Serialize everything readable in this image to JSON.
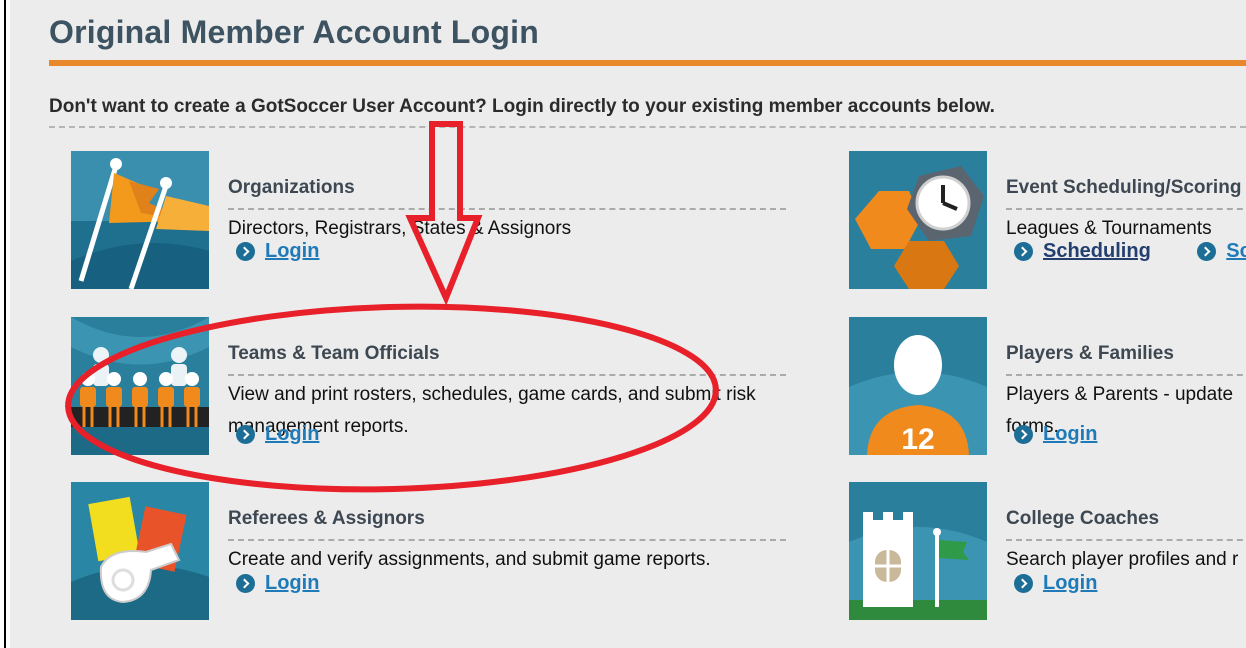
{
  "page": {
    "title": "Original Member Account Login",
    "intro": "Don't want to create a GotSoccer User Account? Login directly to your existing member accounts below."
  },
  "accounts": [
    {
      "title": "Organizations",
      "description": "Directors, Registrars, States & Assignors",
      "links": [
        {
          "label": "Login"
        }
      ],
      "icon": "flags-icon"
    },
    {
      "title": "Teams & Team Officials",
      "description": "View and print rosters, schedules, game cards, and submit risk management reports.",
      "links": [
        {
          "label": "Login"
        }
      ],
      "icon": "team-players-icon"
    },
    {
      "title": "Referees & Assignors",
      "description": "Create and verify assignments, and submit game reports.",
      "links": [
        {
          "label": "Login"
        }
      ],
      "icon": "whistle-cards-icon"
    },
    {
      "title": "Event Scheduling/Scoring",
      "description": "Leagues & Tournaments",
      "links": [
        {
          "label": "Scheduling"
        },
        {
          "label": "Sc"
        }
      ],
      "icon": "clock-hexagon-icon"
    },
    {
      "title": "Players & Families",
      "description": "Players & Parents - update forms.",
      "links": [
        {
          "label": "Login"
        }
      ],
      "icon": "player-silhouette-icon",
      "jersey_number": "12"
    },
    {
      "title": "College Coaches",
      "description": "Search player profiles and r",
      "links": [
        {
          "label": "Login"
        }
      ],
      "icon": "college-tower-icon"
    }
  ],
  "colors": {
    "accent_orange": "#e8882a",
    "title_text": "#3d5362",
    "link": "#1e7ab8",
    "annotation_red": "#e8202a"
  }
}
